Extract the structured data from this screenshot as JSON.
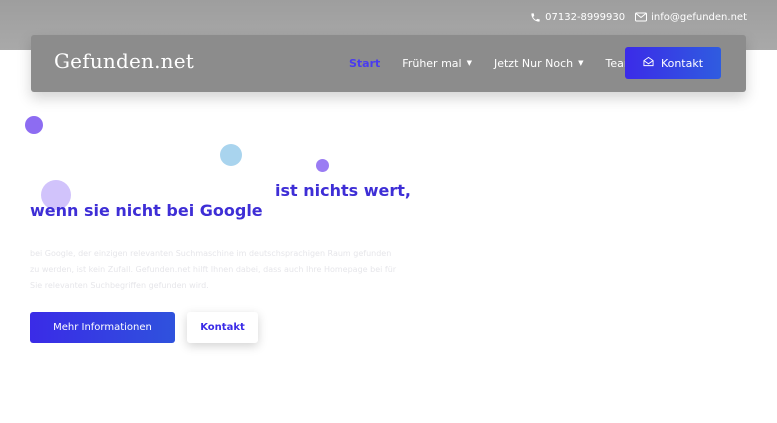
{
  "topbar": {
    "phone": "07132-8999930",
    "email": "info@gefunden.net",
    "phone_icon": "phone-icon",
    "email_icon": "envelope-icon"
  },
  "header": {
    "logo": "Gefunden.net",
    "menu": [
      {
        "label": "Start",
        "active": true,
        "dropdown": false
      },
      {
        "label": "Früher mal",
        "active": false,
        "dropdown": true
      },
      {
        "label": "Jetzt Nur Noch",
        "active": false,
        "dropdown": true
      },
      {
        "label": "Team",
        "active": false,
        "dropdown": false
      }
    ],
    "contact_button": "Kontakt",
    "contact_icon": "envelope-open-icon"
  },
  "hero": {
    "headline_part1": "ist nichts wert,",
    "headline_part2": "wenn sie nicht bei Google",
    "description": "bei Google, der einzigen relevanten Suchmaschine im deutschsprachigen Raum gefunden zu werden, ist kein Zufall. Gefunden.net hilft Ihnen dabei, dass auch Ihre Homepage bei für Sie relevanten Suchbegriffen gefunden wird.",
    "primary_button": "Mehr Informationen",
    "secondary_button": "Kontakt"
  },
  "colors": {
    "accent": "#3e2ed6",
    "button_gradient_start": "#3a2be7",
    "button_gradient_end": "#2f52dd"
  }
}
